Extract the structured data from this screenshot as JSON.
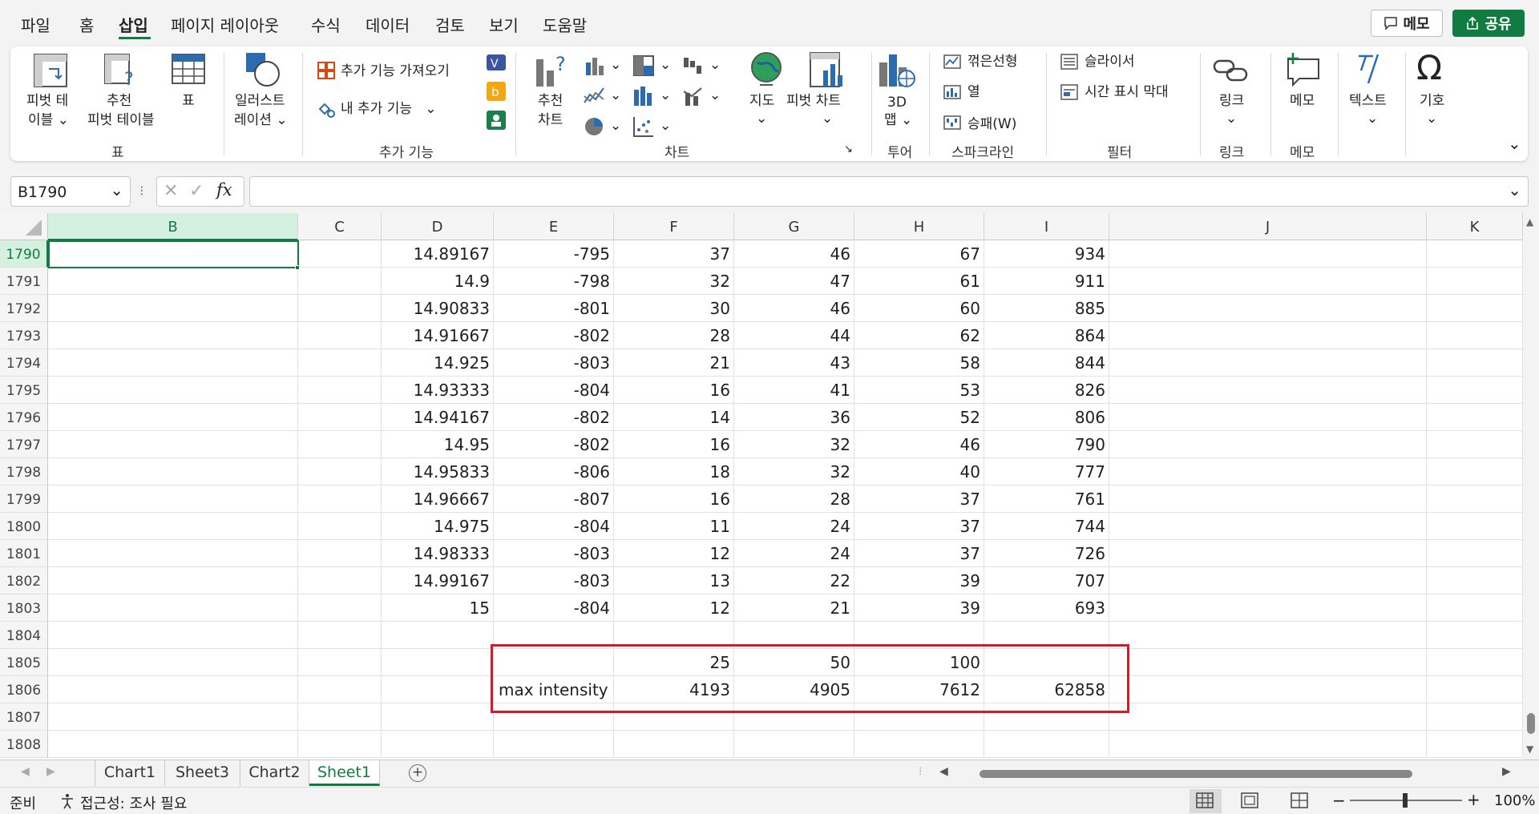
{
  "menu": {
    "items": [
      "파일",
      "홈",
      "삽입",
      "페이지 레이아웃",
      "수식",
      "데이터",
      "검토",
      "보기",
      "도움말"
    ],
    "memo_button": "메모",
    "share_button": "공유"
  },
  "ribbon": {
    "table": {
      "pivot_table": "피벗 테",
      "pivot_table2": "이블",
      "recommended_pivot": "추천",
      "recommended_pivot2": "피벗 테이블",
      "table": "표",
      "group": "표"
    },
    "illustration": {
      "label": "일러스트",
      "label2": "레이션"
    },
    "addins": {
      "get_addins": "추가 기능 가져오기",
      "my_addins": "내 추가 기능",
      "group": "추가 기능"
    },
    "charts": {
      "recommended": "추천",
      "recommended2": "차트",
      "map": "지도",
      "pivot_chart": "피벗 차트",
      "group": "차트"
    },
    "tour": {
      "map3d": "3D",
      "map3d2": "맵",
      "group": "투어"
    },
    "sparklines": {
      "line": "꺾은선형",
      "column": "열",
      "winloss": "승패(W)",
      "group": "스파크라인"
    },
    "filters": {
      "slicer": "슬라이서",
      "timeline": "시간 표시 막대",
      "group": "필터"
    },
    "links": {
      "link": "링크",
      "group": "링크"
    },
    "comments": {
      "memo": "메모",
      "group": "메모"
    },
    "text": {
      "label": "텍스트"
    },
    "symbols": {
      "label": "기호"
    }
  },
  "formula_bar": {
    "name_box": "B1790",
    "fx": "fx",
    "formula": ""
  },
  "columns": [
    "B",
    "C",
    "D",
    "E",
    "F",
    "G",
    "H",
    "I",
    "J",
    "K"
  ],
  "rows": [
    {
      "n": "1790",
      "D": "14.89167",
      "E": "-795",
      "F": "37",
      "G": "46",
      "H": "67",
      "I": "934"
    },
    {
      "n": "1791",
      "D": "14.9",
      "E": "-798",
      "F": "32",
      "G": "47",
      "H": "61",
      "I": "911"
    },
    {
      "n": "1792",
      "D": "14.90833",
      "E": "-801",
      "F": "30",
      "G": "46",
      "H": "60",
      "I": "885"
    },
    {
      "n": "1793",
      "D": "14.91667",
      "E": "-802",
      "F": "28",
      "G": "44",
      "H": "62",
      "I": "864"
    },
    {
      "n": "1794",
      "D": "14.925",
      "E": "-803",
      "F": "21",
      "G": "43",
      "H": "58",
      "I": "844"
    },
    {
      "n": "1795",
      "D": "14.93333",
      "E": "-804",
      "F": "16",
      "G": "41",
      "H": "53",
      "I": "826"
    },
    {
      "n": "1796",
      "D": "14.94167",
      "E": "-802",
      "F": "14",
      "G": "36",
      "H": "52",
      "I": "806"
    },
    {
      "n": "1797",
      "D": "14.95",
      "E": "-802",
      "F": "16",
      "G": "32",
      "H": "46",
      "I": "790"
    },
    {
      "n": "1798",
      "D": "14.95833",
      "E": "-806",
      "F": "18",
      "G": "32",
      "H": "40",
      "I": "777"
    },
    {
      "n": "1799",
      "D": "14.96667",
      "E": "-807",
      "F": "16",
      "G": "28",
      "H": "37",
      "I": "761"
    },
    {
      "n": "1800",
      "D": "14.975",
      "E": "-804",
      "F": "11",
      "G": "24",
      "H": "37",
      "I": "744"
    },
    {
      "n": "1801",
      "D": "14.98333",
      "E": "-803",
      "F": "12",
      "G": "24",
      "H": "37",
      "I": "726"
    },
    {
      "n": "1802",
      "D": "14.99167",
      "E": "-803",
      "F": "13",
      "G": "22",
      "H": "39",
      "I": "707"
    },
    {
      "n": "1803",
      "D": "15",
      "E": "-804",
      "F": "12",
      "G": "21",
      "H": "39",
      "I": "693"
    },
    {
      "n": "1804"
    },
    {
      "n": "1805",
      "F": "25",
      "G": "50",
      "H": "100"
    },
    {
      "n": "1806",
      "E": "max intensity",
      "F": "4193",
      "G": "4905",
      "H": "7612",
      "I": "62858"
    },
    {
      "n": "1807"
    },
    {
      "n": "1808"
    }
  ],
  "sheets": [
    "Chart1",
    "Sheet3",
    "Chart2",
    "Sheet1"
  ],
  "active_sheet": "Sheet1",
  "status": {
    "ready": "준비",
    "accessibility": "접근성: 조사 필요",
    "zoom": "100%"
  },
  "colors": {
    "accent": "#107c41",
    "highlight_box": "#d9182c"
  }
}
